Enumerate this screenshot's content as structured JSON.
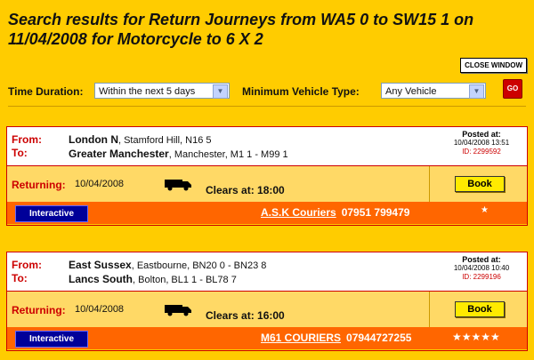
{
  "page": {
    "title": "Search results for Return Journeys from WA5 0 to SW15 1 on 11/04/2008 for Motorcycle to 6 X 2",
    "close_label": "CLOSE WINDOW"
  },
  "filters": {
    "time_label": "Time Duration:",
    "time_value": "Within the next 5 days",
    "vehicle_label": "Minimum Vehicle Type:",
    "vehicle_value": "Any Vehicle",
    "go_label": "GO"
  },
  "results": [
    {
      "from_label": "From:",
      "from_place": "London N",
      "from_detail": ", Stamford Hill, N16 5",
      "to_label": "To:",
      "to_place": "Greater Manchester",
      "to_detail": ", Manchester, M1 1 - M99 1",
      "posted_label": "Posted at:",
      "posted_at": "10/04/2008 13:51",
      "id": "ID: 2299592",
      "returning_label": "Returning:",
      "returning_date": "10/04/2008",
      "clears": "Clears at: 18:00",
      "book_label": "Book",
      "interactive_label": "Interactive",
      "company": "A.S.K Couriers",
      "phone": "07951 799479",
      "rating": "★"
    },
    {
      "from_label": "From:",
      "from_place": "East Sussex",
      "from_detail": ", Eastbourne, BN20 0 - BN23 8",
      "to_label": "To:",
      "to_place": "Lancs South",
      "to_detail": ", Bolton, BL1 1 - BL78 7",
      "posted_label": "Posted at:",
      "posted_at": "10/04/2008 10:40",
      "id": "ID: 2299196",
      "returning_label": "Returning:",
      "returning_date": "10/04/2008",
      "clears": "Clears at: 16:00",
      "book_label": "Book",
      "interactive_label": "Interactive",
      "company": "M61 COURIERS",
      "phone": "07944727255",
      "rating": "★★★★★"
    }
  ]
}
